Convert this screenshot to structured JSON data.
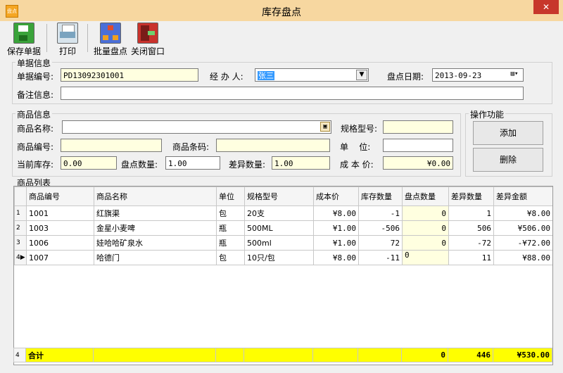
{
  "window": {
    "title": "库存盘点",
    "app_icon_label": "盘点",
    "close_label": "✕"
  },
  "toolbar": {
    "save": "保存单据",
    "print": "打印",
    "batch": "批量盘点",
    "close": "关闭窗口"
  },
  "doc_info": {
    "legend": "单据信息",
    "doc_no_label": "单据编号:",
    "doc_no": "PD13092301001",
    "handler_label": "经 办 人:",
    "handler": "张三",
    "date_label": "盘点日期:",
    "date": "2013-09-23",
    "remark_label": "备注信息:",
    "remark": ""
  },
  "goods_info": {
    "legend": "商品信息",
    "name_label": "商品名称:",
    "name": "",
    "spec_label": "规格型号:",
    "spec": "",
    "code_label": "商品编号:",
    "code": "",
    "barcode_label": "商品条码:",
    "barcode": "",
    "unit_label": "单    位:",
    "unit": "",
    "stock_label": "当前库存:",
    "stock": "0.00",
    "count_label": "盘点数量:",
    "count": "1.00",
    "diff_label": "差异数量:",
    "diff": "1.00",
    "cost_label": "成 本 价:",
    "cost": "¥0.00"
  },
  "ops": {
    "legend": "操作功能",
    "add": "添加",
    "delete": "删除"
  },
  "list": {
    "legend": "商品列表",
    "headers": [
      "商品编号",
      "商品名称",
      "单位",
      "规格型号",
      "成本价",
      "库存数量",
      "盘点数量",
      "差异数量",
      "差异金额"
    ],
    "rows": [
      {
        "idx": "1",
        "code": "1001",
        "name": "红旗渠",
        "unit": "包",
        "spec": "20支",
        "cost": "¥8.00",
        "stock": "-1",
        "count": "0",
        "diff": "1",
        "amount": "¥8.00"
      },
      {
        "idx": "2",
        "code": "1003",
        "name": "金星小麦啤",
        "unit": "瓶",
        "spec": "500ML",
        "cost": "¥1.00",
        "stock": "-506",
        "count": "0",
        "diff": "506",
        "amount": "¥506.00"
      },
      {
        "idx": "3",
        "code": "1006",
        "name": "娃哈哈矿泉水",
        "unit": "瓶",
        "spec": "500ml",
        "cost": "¥1.00",
        "stock": "72",
        "count": "0",
        "diff": "-72",
        "amount": "-¥72.00"
      },
      {
        "idx": "4",
        "code": "1007",
        "name": "哈德门",
        "unit": "包",
        "spec": "10只/包",
        "cost": "¥8.00",
        "stock": "-11",
        "count": "0",
        "diff": "11",
        "amount": "¥88.00"
      }
    ],
    "total": {
      "idx": "4",
      "label": "合计",
      "count": "0",
      "diff": "446",
      "amount": "¥530.00"
    }
  }
}
